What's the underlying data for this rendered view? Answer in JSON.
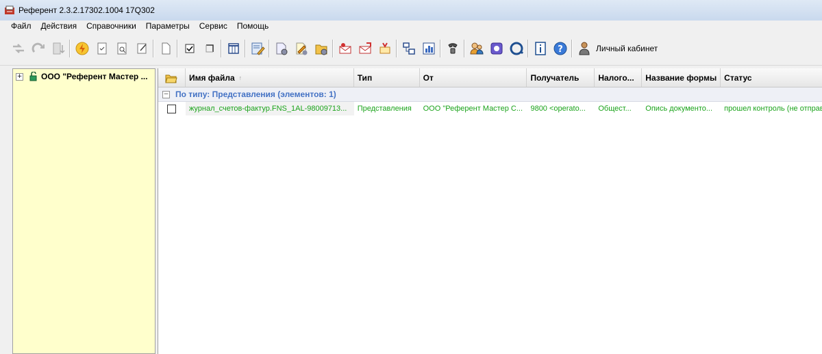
{
  "window": {
    "title": "Референт 2.3.2.17302.1004 17Q302"
  },
  "menu": [
    "Файл",
    "Действия",
    "Справочники",
    "Параметры",
    "Сервис",
    "Помощь"
  ],
  "toolbar": {
    "account_label": "Личный кабинет"
  },
  "tree": {
    "root_label": "ООО \"Референт Мастер ...",
    "expander": "+"
  },
  "grid": {
    "columns": [
      "Имя файла",
      "Тип",
      "От",
      "Получатель",
      "Налого...",
      "Название формы",
      "Статус"
    ],
    "sort_glyph": "↑",
    "group": {
      "expander": "−",
      "label": "По типу: Представления (элементов: 1)"
    },
    "rows": [
      {
        "file": "журнал_счетов-фактур.FNS_1AL-98009713...",
        "type": "Представления",
        "from": "ООО \"Референт Мастер С...",
        "recipient": "9800 <operato...",
        "tax": "Общест...",
        "form": "Опись документо...",
        "status": "прошел контроль (не отправ"
      }
    ]
  },
  "colors": {
    "accent": "#4472c4",
    "row_text": "#1aa31a",
    "tree_bg": "#ffffcc"
  }
}
